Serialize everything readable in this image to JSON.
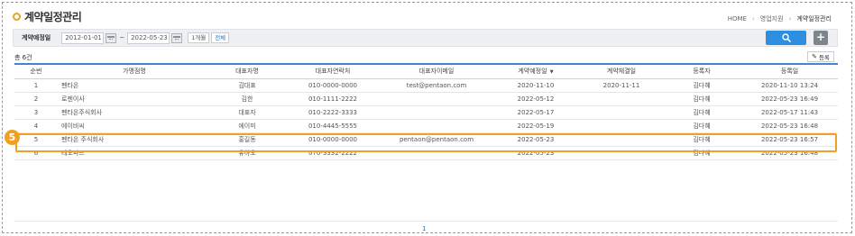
{
  "header": {
    "title": "계약일정관리",
    "breadcrumb": [
      "HOME",
      "영업지원",
      "계약일정관리"
    ]
  },
  "search": {
    "label": "계약예정일",
    "date_from": "2012-01-01",
    "date_to": "2022-05-23",
    "tilde": "~",
    "period_1m": "1개월",
    "period_all": "전체"
  },
  "list": {
    "count_text": "총 6건",
    "register_label": "등록",
    "columns": [
      "순번",
      "가맹점명",
      "대표자명",
      "대표자연락처",
      "대표자이메일",
      "계약예정일",
      "계약체결일",
      "등록자",
      "등록일"
    ],
    "sort_indicator": "▼",
    "rows": [
      [
        "1",
        "펜타온",
        "김대표",
        "010-0000-0000",
        "test@pentaon.com",
        "2020-11-10",
        "2020-11-11",
        "김다혜",
        "2020-11-10 13:24"
      ],
      [
        "2",
        "로젠이사",
        "김한",
        "010-1111-2222",
        "",
        "2022-05-12",
        "",
        "김다혜",
        "2022-05-23 16:49"
      ],
      [
        "3",
        "펜타온주식회사",
        "대표자",
        "010-2222-3333",
        "",
        "2022-05-17",
        "",
        "김다혜",
        "2022-05-17 11:43"
      ],
      [
        "4",
        "에이비씨",
        "에이미",
        "010-4445-5555",
        "",
        "2022-05-19",
        "",
        "김다혜",
        "2022-05-23 16:48"
      ],
      [
        "5",
        "펜타온 주식회사",
        "홍길동",
        "010-0000-0000",
        "pentaon@pentaon.com",
        "2022-05-23",
        "",
        "김다혜",
        "2022-05-23 16:57"
      ],
      [
        "6",
        "레오파드",
        "유하오",
        "070-3332-2222",
        "",
        "2022-05-23",
        "",
        "김다혜",
        "2022-05-23 16:48"
      ]
    ]
  },
  "highlight": {
    "marker": "5",
    "color": "#f0a024"
  },
  "pagination": {
    "current_page": "1"
  },
  "colors": {
    "accent": "#f0a024",
    "primary_button": "#2e8fe0",
    "table_header_line": "#4c82c6"
  },
  "icons": {
    "search_button": "search-icon",
    "add_button": "plus-icon",
    "date_picker": "calendar-icon",
    "register_button": "pencil-icon"
  }
}
